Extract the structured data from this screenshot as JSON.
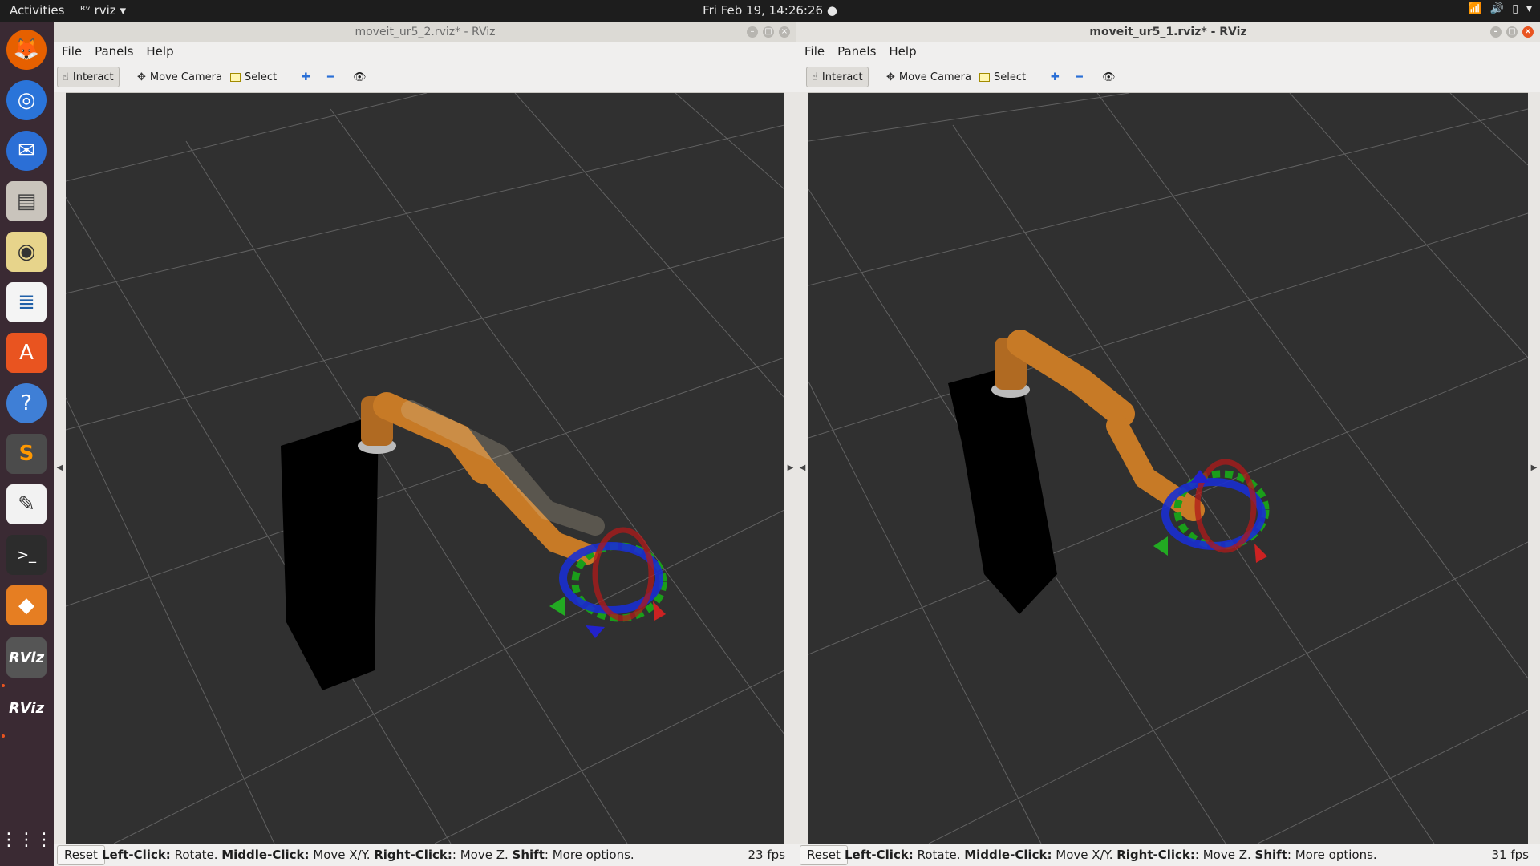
{
  "topbar": {
    "activities": "Activities",
    "app_menu": "rviz",
    "clock": "Fri Feb 19, 14:26:26 ●",
    "tray_icons": [
      "wifi-icon",
      "volume-icon",
      "battery-icon",
      "chevron-down-icon"
    ]
  },
  "dock": {
    "apps": [
      "firefox-icon",
      "chromium-icon",
      "thunderbird-icon",
      "files-icon",
      "rhythmbox-icon",
      "writer-icon",
      "software-center-icon",
      "help-icon",
      "sublime-text-icon",
      "text-editor-icon",
      "terminal-icon",
      "layers-icon",
      "rviz-icon",
      "rviz-icon",
      "show-apps-icon"
    ],
    "rviz_label": "RViz"
  },
  "windows": {
    "left": {
      "title": "moveit_ur5_2.rviz* - RViz",
      "menus": {
        "file": "File",
        "panels": "Panels",
        "help": "Help"
      },
      "tools": {
        "interact": "Interact",
        "move_camera": "Move Camera",
        "select": "Select"
      },
      "status": {
        "reset": "Reset",
        "fps": "23 fps"
      }
    },
    "right": {
      "title": "moveit_ur5_1.rviz* - RViz",
      "menus": {
        "file": "File",
        "panels": "Panels",
        "help": "Help"
      },
      "tools": {
        "interact": "Interact",
        "move_camera": "Move Camera",
        "select": "Select"
      },
      "status": {
        "reset": "Reset",
        "fps": "31 fps"
      }
    }
  },
  "status_hint": {
    "lc": "Left-Click:",
    "lc_t": " Rotate. ",
    "mc": "Middle-Click:",
    "mc_t": " Move X/Y. ",
    "rc": "Right-Click:",
    "rc_t": ": Move Z. ",
    "sh": "Shift",
    "sh_t": ": More options."
  },
  "colors": {
    "accent": "#e95420",
    "viewport": "#303030",
    "robot": "#c77a26"
  }
}
